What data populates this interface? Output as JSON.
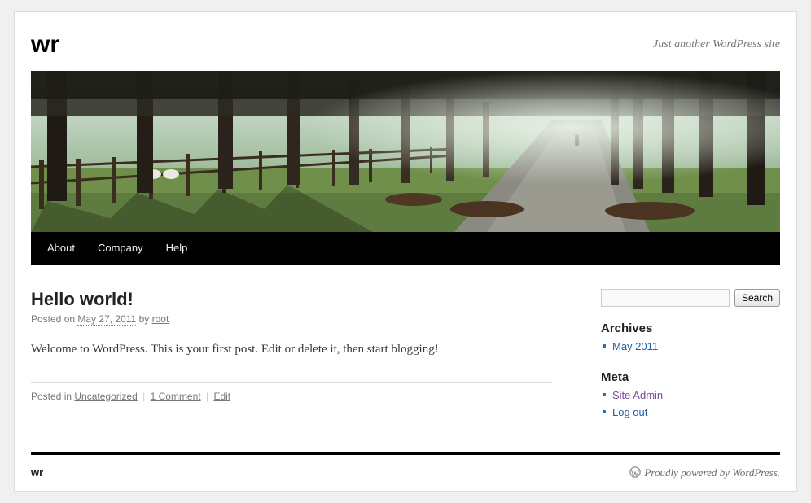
{
  "site": {
    "title": "wr",
    "tagline": "Just another WordPress site"
  },
  "nav": {
    "items": [
      "About",
      "Company",
      "Help"
    ]
  },
  "post": {
    "title": "Hello world!",
    "posted_on_label": "Posted on",
    "date": "May 27, 2011",
    "by_label": "by",
    "author": "root",
    "content": "Welcome to WordPress. This is your first post. Edit or delete it, then start blogging!",
    "posted_in_label": "Posted in",
    "category": "Uncategorized",
    "comments": "1 Comment",
    "edit": "Edit"
  },
  "search": {
    "button": "Search",
    "value": ""
  },
  "widgets": {
    "archives": {
      "title": "Archives",
      "items": [
        "May 2011"
      ]
    },
    "meta": {
      "title": "Meta",
      "items": [
        "Site Admin",
        "Log out"
      ]
    }
  },
  "footer": {
    "left": "wr",
    "right": "Proudly powered by WordPress.",
    "icon": "wordpress-logo-icon"
  }
}
